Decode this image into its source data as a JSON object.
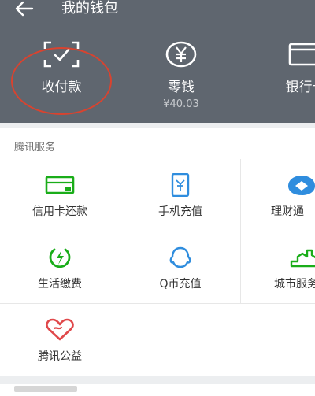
{
  "app": {
    "title": "我的钱包"
  },
  "header": {
    "items": [
      {
        "label": "收付款",
        "sub": ""
      },
      {
        "label": "零钱",
        "sub": "¥40.03"
      },
      {
        "label": "银行卡",
        "sub": ""
      }
    ]
  },
  "section": {
    "title": "腾讯服务"
  },
  "services": [
    {
      "label": "信用卡还款",
      "icon": "credit-card-icon"
    },
    {
      "label": "手机充值",
      "icon": "phone-topup-icon"
    },
    {
      "label": "理财通",
      "icon": "wealth-icon"
    },
    {
      "label": "生活缴费",
      "icon": "utility-bill-icon"
    },
    {
      "label": "Q币充值",
      "icon": "qcoin-icon"
    },
    {
      "label": "城市服务",
      "icon": "city-service-icon"
    },
    {
      "label": "腾讯公益",
      "icon": "charity-icon"
    }
  ],
  "colors": {
    "header_bg": "#5f666f",
    "accent_green": "#1aad19",
    "accent_blue": "#2f8dde",
    "accent_red": "#e0484a",
    "annotation_red": "#d9432f"
  }
}
